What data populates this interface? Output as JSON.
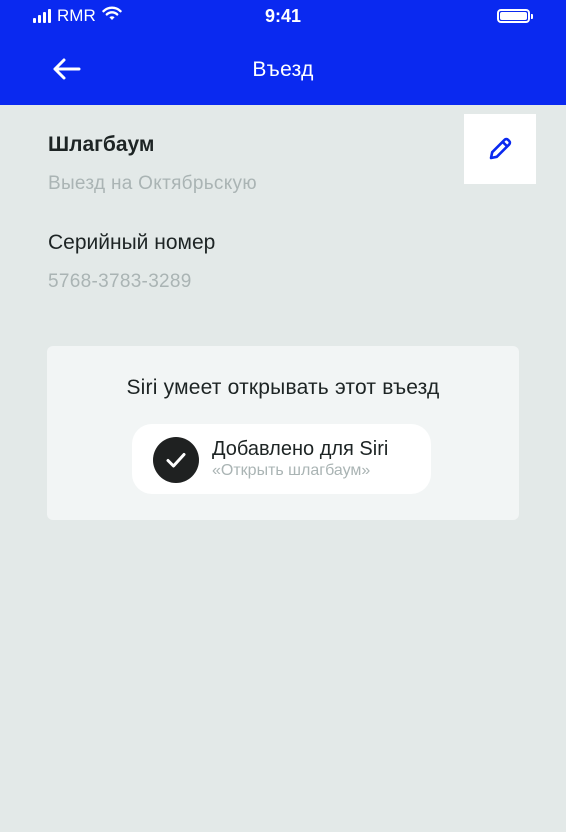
{
  "status_bar": {
    "carrier": "RMR",
    "time": "9:41",
    "icons": [
      "signal-icon",
      "wifi-icon",
      "battery-icon"
    ]
  },
  "header": {
    "back_icon": "arrow-left-icon",
    "title": "Въезд",
    "background": "#0a29f0"
  },
  "barrier": {
    "label": "Шлагбаум",
    "value": "Выезд на Октябрьскую",
    "edit_icon": "pencil-icon"
  },
  "serial": {
    "label": "Серийный номер",
    "value": "5768-3783-3289"
  },
  "siri": {
    "title": "Siri умеет открывать этот въезд",
    "added_label": "Добавлено для Siri",
    "phrase": "«Открыть шлагбаум»",
    "check_icon": "check-icon"
  },
  "colors": {
    "accent": "#0a29f0",
    "background": "#e3e9e8",
    "card": "#f2f5f5",
    "secondary_text": "#aab4b4",
    "primary_text": "#1d2424"
  }
}
